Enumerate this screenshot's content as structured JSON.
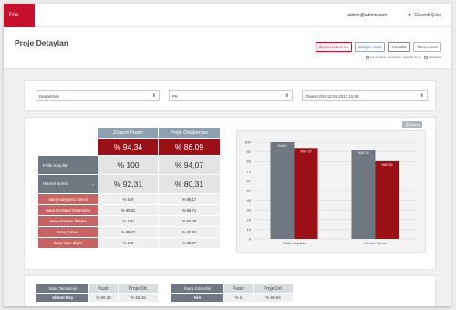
{
  "app": {
    "brand": "Fna",
    "user_email": "admin@admin.com",
    "logout_label": "Güvenli Çıkış"
  },
  "page": {
    "title": "Proje Detayları",
    "buttons": [
      {
        "label": "Ziyaret Listesi V1",
        "style": "red"
      },
      {
        "label": "Detaylı Analiz",
        "style": "blue"
      },
      {
        "label": "Yorumlar",
        "style": "dark"
      },
      {
        "label": "Talep Listesi",
        "style": "gray"
      }
    ],
    "checkboxes": [
      {
        "label": "OKUNDU OLARAK İŞARETLE",
        "checked": false
      },
      {
        "label": "BRAVO",
        "checked": false
      }
    ]
  },
  "filters": [
    {
      "value": "Departman"
    },
    {
      "value": "P6"
    },
    {
      "value": "Ziyaret 002 12.09.2017 15:55"
    }
  ],
  "score_table": {
    "headers": [
      "Ziyaret Puanı",
      "Proje Ortalaması"
    ],
    "overall": [
      "% 94,34",
      "% 86,09"
    ],
    "sections": [
      {
        "label": "Fiziki Koşullar",
        "values": [
          "% 100",
          "% 94,07"
        ],
        "expandable": false
      },
      {
        "label": "Hizmet Süreci",
        "values": [
          "% 92,31",
          "% 80,31"
        ],
        "expandable": true
      }
    ],
    "sub_rows": [
      {
        "label": "Satış-Karşılama Süreci",
        "values": [
          "% 100",
          "% 85,17"
        ]
      },
      {
        "label": "Satış-Personel Görünümü",
        "values": [
          "% 90,91",
          "% 95,71"
        ]
      },
      {
        "label": "Satış-Hizmete İletişim",
        "values": [
          "% 100",
          "% 82,08"
        ]
      },
      {
        "label": "Satış Çabası",
        "values": [
          "% 66,67",
          "% 62,92"
        ]
      },
      {
        "label": "Satış-Ürün Bilgisi",
        "values": [
          "% 100",
          "% 80,67"
        ]
      }
    ]
  },
  "print_label": "Yazdır",
  "chart_data": {
    "type": "bar",
    "categories": [
      "Fiziki Koşullar",
      "Hizmet Süreci"
    ],
    "series": [
      {
        "name": "Ziyaret Puanı",
        "values": [
          100,
          92.31
        ],
        "labels": [
          "%100",
          "%92.31"
        ],
        "color": "#6f7780"
      },
      {
        "name": "Proje Ortalaması",
        "values": [
          94.07,
          80.31
        ],
        "labels": [
          "%94.07",
          "%80.31"
        ],
        "color": "#9b0f17"
      }
    ],
    "yticks": [
      0,
      10,
      20,
      30,
      40,
      50,
      60,
      70,
      80,
      90,
      100
    ],
    "ylim": [
      0,
      100
    ],
    "grid": true,
    "legend": "none"
  },
  "bottom_tables": [
    {
      "title": "Satış Temsilcisi",
      "columns": [
        "Puanı",
        "Proje Ort."
      ],
      "rows": [
        {
          "name": "Ahmet Bey",
          "values": [
            "% 90,32",
            "% 82,45"
          ]
        }
      ]
    },
    {
      "title": "Kasa Görevlisi",
      "columns": [
        "Puanı",
        "Proje Ort."
      ],
      "rows": [
        {
          "name": "N/A",
          "values": [
            "% 0",
            "% 90,94"
          ]
        }
      ]
    }
  ]
}
